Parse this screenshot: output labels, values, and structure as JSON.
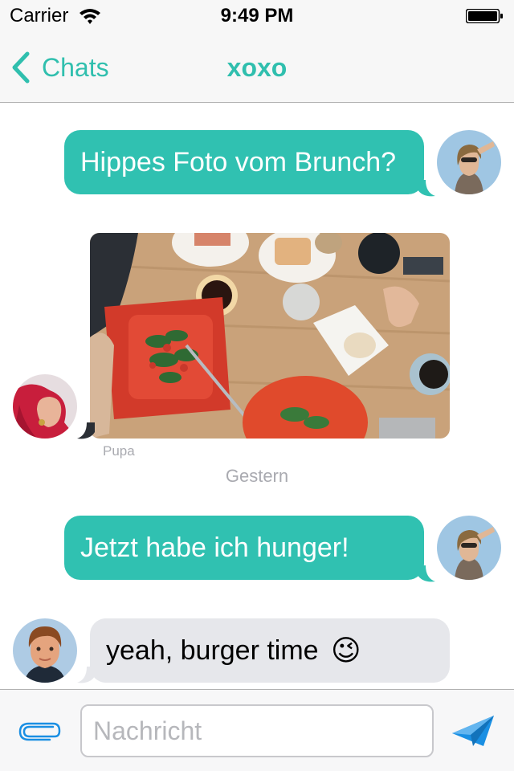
{
  "status_bar": {
    "carrier": "Carrier",
    "time": "9:49 PM"
  },
  "nav": {
    "back_label": "Chats",
    "title": "xoxo"
  },
  "messages": [
    {
      "direction": "outgoing",
      "type": "text",
      "text": "Hippes Foto vom Brunch?"
    },
    {
      "direction": "incoming",
      "type": "image",
      "image_alt": "brunch table with salad plates and coffee",
      "sender": "Pupa"
    },
    {
      "direction": "outgoing",
      "type": "text",
      "text": "Jetzt habe ich hunger!"
    },
    {
      "direction": "incoming",
      "type": "text",
      "text": "yeah, burger time",
      "emoji": "😉"
    }
  ],
  "date_separator": "Gestern",
  "input": {
    "placeholder": "Nachricht",
    "value": ""
  },
  "colors": {
    "accent": "#30bfae",
    "outgoing_bubble": "#30c1b1",
    "incoming_bubble": "#e6e7eb",
    "secondary_text": "#a9aab0",
    "icon_blue": "#1a8fe3"
  },
  "icons": [
    "wifi-icon",
    "battery-icon",
    "back-chevron-icon",
    "paperclip-icon",
    "send-icon"
  ]
}
